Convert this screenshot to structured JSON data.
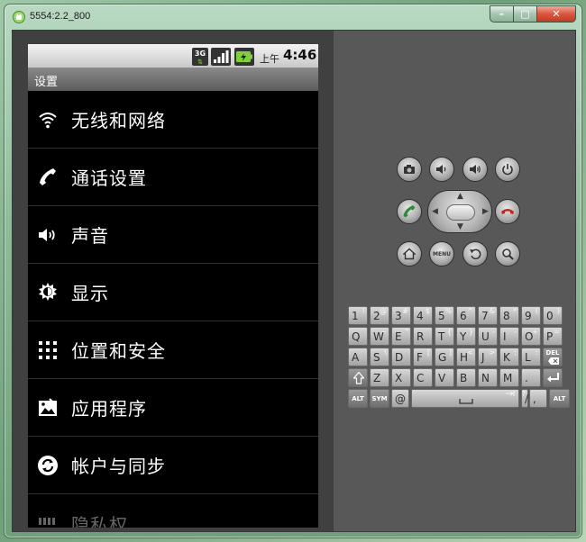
{
  "window": {
    "title": "5554:2.2_800",
    "controls": {
      "minimize": "–",
      "maximize": "□",
      "close": "✕"
    }
  },
  "status_bar": {
    "network_badge": "3G",
    "time_prefix": "上午",
    "time": "4:46"
  },
  "screen_title": "设置",
  "menu_items": [
    {
      "label": "无线和网络",
      "icon": "wifi-icon"
    },
    {
      "label": "通话设置",
      "icon": "phone-icon"
    },
    {
      "label": "声音",
      "icon": "speaker-icon"
    },
    {
      "label": "显示",
      "icon": "brightness-icon"
    },
    {
      "label": "位置和安全",
      "icon": "location-grid-icon"
    },
    {
      "label": "应用程序",
      "icon": "applications-icon"
    },
    {
      "label": "帐户与同步",
      "icon": "sync-icon"
    },
    {
      "label": "隐私权",
      "icon": "privacy-icon"
    }
  ],
  "hardware_buttons": {
    "menu_label": "MENU",
    "top_row": [
      "camera-icon",
      "volume-down-icon",
      "volume-up-icon",
      "power-icon"
    ],
    "middle_row": [
      "call-icon",
      "dpad",
      "end-call-icon"
    ],
    "bottom_row": [
      "home-icon",
      "menu-button",
      "back-icon",
      "search-icon"
    ]
  },
  "keyboard": {
    "row1": [
      {
        "main": "1",
        "shift": "!"
      },
      {
        "main": "2",
        "shift": "@"
      },
      {
        "main": "3",
        "shift": "#"
      },
      {
        "main": "4",
        "shift": "$"
      },
      {
        "main": "5",
        "shift": "%"
      },
      {
        "main": "6",
        "shift": "^"
      },
      {
        "main": "7",
        "shift": "&"
      },
      {
        "main": "8",
        "shift": "*"
      },
      {
        "main": "9",
        "shift": "("
      },
      {
        "main": "0",
        "shift": ")"
      }
    ],
    "row2": [
      {
        "main": "Q",
        "shift": ""
      },
      {
        "main": "W",
        "shift": "~"
      },
      {
        "main": "E",
        "shift": "\""
      },
      {
        "main": "R",
        "shift": ""
      },
      {
        "main": "T",
        "shift": "{"
      },
      {
        "main": "Y",
        "shift": "}"
      },
      {
        "main": "U",
        "shift": "-"
      },
      {
        "main": "I",
        "shift": "-"
      },
      {
        "main": "O",
        "shift": "+"
      },
      {
        "main": "P",
        "shift": "="
      }
    ],
    "row3": [
      {
        "main": "A",
        "shift": ""
      },
      {
        "main": "S",
        "shift": "\\"
      },
      {
        "main": "D",
        "shift": ""
      },
      {
        "main": "F",
        "shift": "["
      },
      {
        "main": "G",
        "shift": "]"
      },
      {
        "main": "H",
        "shift": "<"
      },
      {
        "main": "J",
        "shift": ">"
      },
      {
        "main": "K",
        "shift": ";"
      },
      {
        "main": "L",
        "shift": ":"
      }
    ],
    "row3_del": "DEL",
    "row4": [
      {
        "main": "Z",
        "shift": ""
      },
      {
        "main": "X",
        "shift": ""
      },
      {
        "main": "C",
        "shift": ""
      },
      {
        "main": "V",
        "shift": ""
      },
      {
        "main": "B",
        "shift": ""
      },
      {
        "main": "N",
        "shift": ""
      },
      {
        "main": "M",
        "shift": ""
      },
      {
        "main": ".",
        "shift": ""
      }
    ],
    "row5": {
      "alt_left": "ALT",
      "sym": "SYM",
      "at": "@",
      "slash": "/",
      "slash_shift": "?",
      "comma": ",",
      "alt_right": "ALT"
    }
  },
  "colors": {
    "screen_background": "#000000",
    "status_bar": "#d9d9d9",
    "title_strip": "#6e6e6e",
    "divider": "#2c2c2c",
    "call_green": "#2f8a3a",
    "end_call_red": "#c0281e"
  }
}
